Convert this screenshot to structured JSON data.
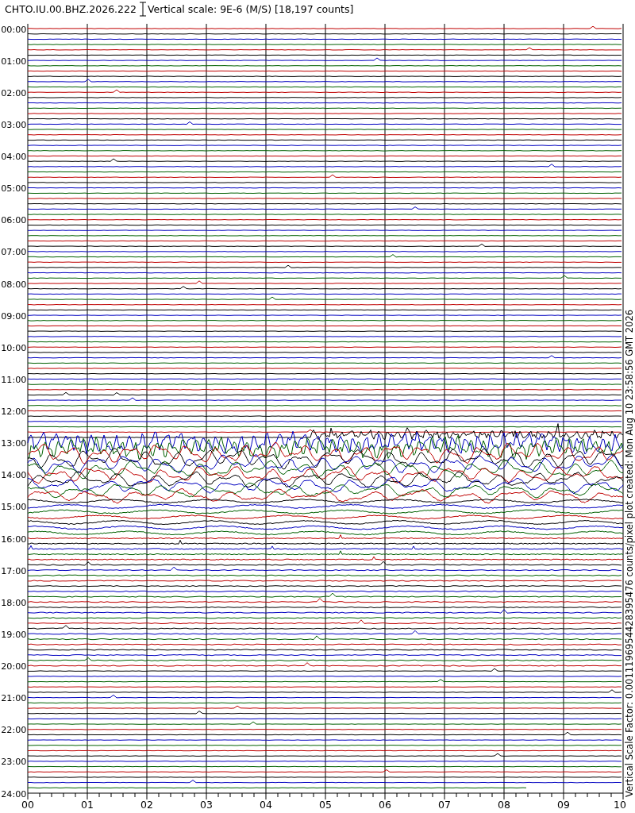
{
  "header": {
    "station": "CHTO.IU.00.BHZ.2026.222",
    "vertical_scale": "Vertical scale: 9E-6 (M/S) [18,197 counts]"
  },
  "plot": {
    "hour_labels": [
      "00:00",
      "01:00",
      "02:00",
      "03:00",
      "04:00",
      "05:00",
      "06:00",
      "07:00",
      "08:00",
      "09:00",
      "10:00",
      "11:00",
      "12:00",
      "13:00",
      "14:00",
      "15:00",
      "16:00",
      "17:00",
      "18:00",
      "19:00",
      "20:00",
      "21:00",
      "22:00",
      "23:00",
      "24:00"
    ],
    "minute_labels": [
      "00",
      "01",
      "02",
      "03",
      "04",
      "05",
      "06",
      "07",
      "08",
      "09",
      "10"
    ],
    "side_note": "Vertical Scale Factor: 0.0011196954428395476 counts/pixel plot created: Mon Aug 10 23:58:56 GMT 2026"
  }
}
